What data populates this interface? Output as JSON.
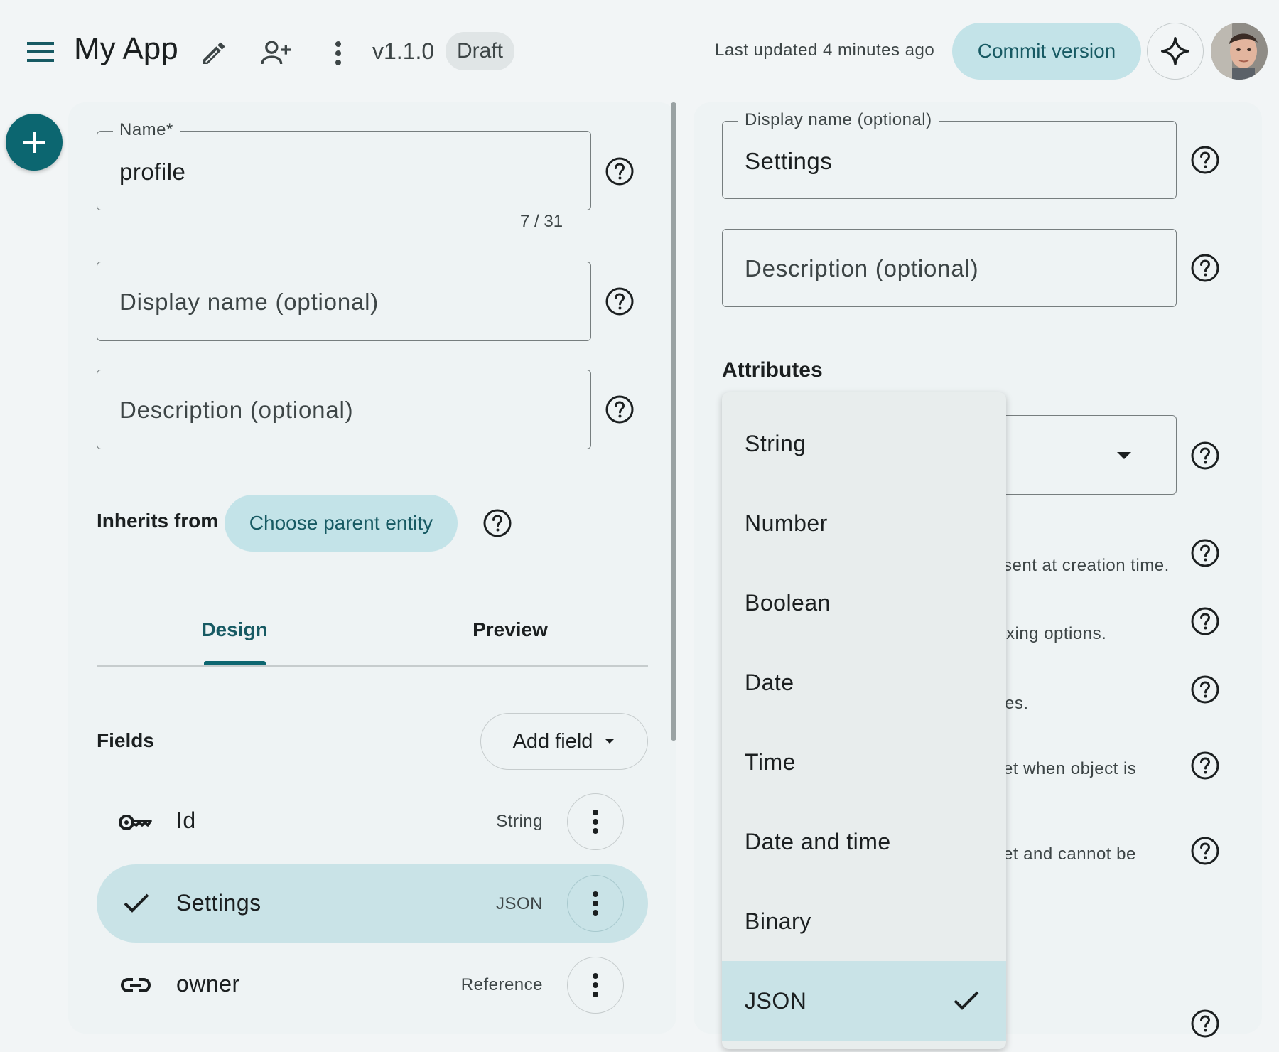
{
  "header": {
    "app_title": "My App",
    "version": "v1.1.0",
    "status_badge": "Draft",
    "last_updated": "Last updated 4 minutes ago",
    "commit_label": "Commit version"
  },
  "entity_form": {
    "name": {
      "label": "Name*",
      "value": "profile",
      "counter": "7 / 31"
    },
    "display_name": {
      "placeholder": "Display name (optional)"
    },
    "description": {
      "placeholder": "Description (optional)"
    },
    "inherits_label": "Inherits from",
    "choose_parent_label": "Choose parent entity",
    "tabs": [
      {
        "label": "Design",
        "active": true
      },
      {
        "label": "Preview",
        "active": false
      }
    ],
    "fields_title": "Fields",
    "add_field_label": "Add field",
    "fields": [
      {
        "name": "Id",
        "type": "String",
        "icon": "key-icon",
        "selected": false
      },
      {
        "name": "Settings",
        "type": "JSON",
        "icon": "check-icon",
        "selected": true
      },
      {
        "name": "owner",
        "type": "Reference",
        "icon": "link-icon",
        "selected": false
      }
    ]
  },
  "field_editor": {
    "display_name": {
      "label": "Display name (optional)",
      "value": "Settings"
    },
    "description": {
      "placeholder": "Description (optional)"
    },
    "attributes_title": "Attributes",
    "hints": [
      "sent at creation time.",
      "xing options.",
      "es.",
      "et when object is",
      "et and cannot be"
    ]
  },
  "type_menu": {
    "options": [
      "String",
      "Number",
      "Boolean",
      "Date",
      "Time",
      "Date and time",
      "Binary",
      "JSON"
    ],
    "selected": "JSON"
  },
  "colors": {
    "accent": "#0c6670",
    "tonal": "#c3e3e8",
    "selected_row": "#c9e3e7",
    "background": "#f2f5f6",
    "panel": "#eef3f4"
  }
}
